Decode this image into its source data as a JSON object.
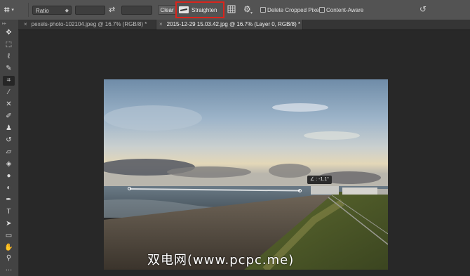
{
  "options_bar": {
    "ratio_value": "Ratio",
    "width_value": "",
    "height_value": "",
    "clear_label": "Clear",
    "straighten_label": "Straighten",
    "delete_cropped_label": "Delete Cropped Pixels",
    "content_aware_label": "Content-Aware",
    "delete_cropped_checked": false,
    "content_aware_checked": false,
    "highlight_color": "#d9251d"
  },
  "tabs": [
    {
      "label": "pexels-photo-102104.jpeg @ 16.7% (RGB/8) *",
      "close": "×",
      "active": false
    },
    {
      "label": "2015-12-29 15.03.42.jpg @ 16.7% (Layer 0, RGB/8) *",
      "close": "×",
      "active": true
    }
  ],
  "tools": [
    {
      "name": "move-tool-icon",
      "glyph": "✥"
    },
    {
      "name": "marquee-tool-icon",
      "glyph": "⬚"
    },
    {
      "name": "lasso-tool-icon",
      "glyph": "ℓ"
    },
    {
      "name": "quick-select-tool-icon",
      "glyph": "✎"
    },
    {
      "name": "crop-tool-icon",
      "glyph": "⌗"
    },
    {
      "name": "eyedropper-tool-icon",
      "glyph": "⁄"
    },
    {
      "name": "healing-tool-icon",
      "glyph": "✕"
    },
    {
      "name": "brush-tool-icon",
      "glyph": "✐"
    },
    {
      "name": "stamp-tool-icon",
      "glyph": "♟"
    },
    {
      "name": "history-brush-tool-icon",
      "glyph": "↺"
    },
    {
      "name": "eraser-tool-icon",
      "glyph": "▱"
    },
    {
      "name": "paint-bucket-tool-icon",
      "glyph": "◈"
    },
    {
      "name": "blur-tool-icon",
      "glyph": "●"
    },
    {
      "name": "dodge-tool-icon",
      "glyph": "◐"
    },
    {
      "name": "pen-tool-icon",
      "glyph": "✒"
    },
    {
      "name": "type-tool-icon",
      "glyph": "T"
    },
    {
      "name": "path-select-tool-icon",
      "glyph": "➤"
    },
    {
      "name": "rectangle-tool-icon",
      "glyph": "▭"
    },
    {
      "name": "hand-tool-icon",
      "glyph": "✋"
    },
    {
      "name": "zoom-tool-icon",
      "glyph": "⚲"
    },
    {
      "name": "more-tools-icon",
      "glyph": "…"
    }
  ],
  "selected_tool": "crop-tool-icon",
  "angle_readout": "-1.1°",
  "watermark": "双电网(www.pcpc.me)"
}
